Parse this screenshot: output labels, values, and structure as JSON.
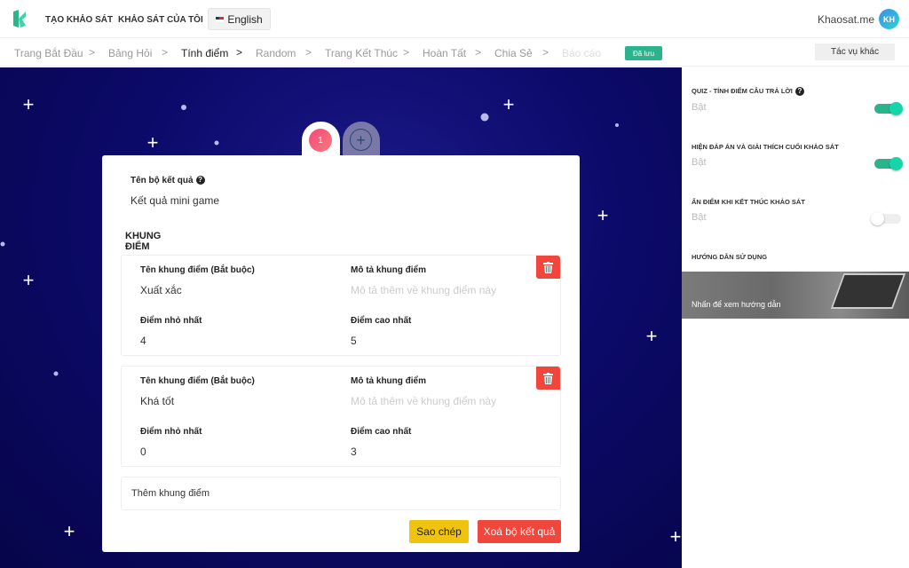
{
  "header": {
    "nav": [
      "TẠO KHẢO SÁT",
      "KHẢO SÁT CỦA TÔI"
    ],
    "language": "English",
    "brand": "Khaosat.me",
    "avatar_initials": "KH"
  },
  "breadcrumb": {
    "steps": [
      "Trang Bắt Đầu",
      "Bảng Hỏi",
      "Tính điểm",
      "Random",
      "Trang Kết Thúc",
      "Hoàn Tất",
      "Chia Sẻ",
      "Báo cáo"
    ],
    "active": "Tính điểm",
    "saved_badge": "Đã lưu",
    "more_actions": "Tác vụ khác"
  },
  "result_set": {
    "tabs": [
      "1"
    ],
    "name_label": "Tên bộ kết quả",
    "name_value": "Kết quả mini game",
    "section_title": "KHUNG ĐIỂM",
    "ranges": [
      {
        "name_label": "Tên khung điểm (Bắt buộc)",
        "name": "Xuất xắc",
        "desc_label": "Mô tả khung điểm",
        "desc_placeholder": "Mô tả thêm về khung điểm này",
        "min_label": "Điểm nhỏ nhất",
        "min": "4",
        "max_label": "Điểm cao nhất",
        "max": "5"
      },
      {
        "name_label": "Tên khung điểm (Bắt buộc)",
        "name": "Khá tốt",
        "desc_label": "Mô tả khung điểm",
        "desc_placeholder": "Mô tả thêm về khung điểm này",
        "min_label": "Điểm nhỏ nhất",
        "min": "0",
        "max_label": "Điểm cao nhất",
        "max": "3"
      }
    ],
    "add_range": "Thêm khung điểm",
    "copy_button": "Sao chép",
    "delete_button": "Xoá bộ kết quả"
  },
  "settings": {
    "items": [
      {
        "title": "QUIZ - TÍNH ĐIỂM CÂU TRẢ LỜI",
        "value": "Bật",
        "on": true
      },
      {
        "title": "HIỆN ĐÁP ÁN VÀ GIẢI THÍCH CUỐI KHẢO SÁT",
        "value": "Bật",
        "on": true
      },
      {
        "title": "ẨN ĐIỂM KHI KẾT THÚC KHẢO SÁT",
        "value": "Bật",
        "on": false
      }
    ],
    "guide_title": "HƯỚNG DẪN SỬ DỤNG",
    "guide_link": "Nhấn để xem hướng dẫn"
  },
  "colors": {
    "accent": "#2bb48c",
    "danger": "#f0463c",
    "warning": "#f0c30f",
    "background": "#0c0a6a",
    "toggle_on": "#14d6a8"
  }
}
